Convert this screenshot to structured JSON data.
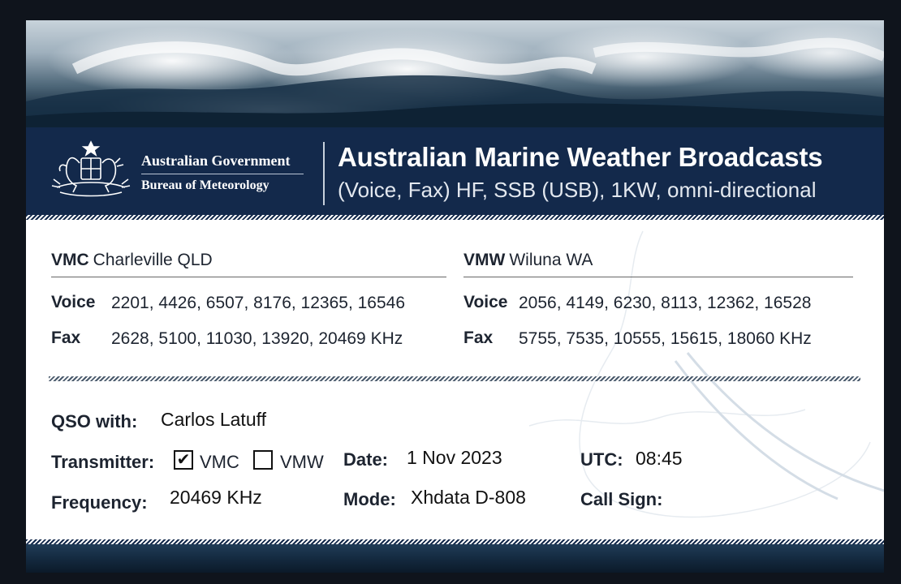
{
  "header": {
    "org_name": "Australian Government",
    "org_sub": "Bureau of Meteorology",
    "title": "Australian Marine Weather Broadcasts",
    "subtitle": "(Voice, Fax) HF, SSB (USB), 1KW, omni-directional"
  },
  "stations": [
    {
      "callsign": "VMC",
      "location": "Charleville QLD",
      "voice_label": "Voice",
      "voice": "2201, 4426, 6507, 8176, 12365, 16546",
      "fax_label": "Fax",
      "fax": "2628, 5100, 11030, 13920, 20469 KHz"
    },
    {
      "callsign": "VMW",
      "location": "Wiluna WA",
      "voice_label": "Voice",
      "voice": "2056, 4149, 6230, 8113, 12362, 16528",
      "fax_label": "Fax",
      "fax": "5755, 7535, 10555, 15615, 18060 KHz"
    }
  ],
  "report": {
    "qso_label": "QSO with:",
    "qso_value": "Carlos Latuff",
    "transmitter_label": "Transmitter:",
    "transmitter_options": [
      {
        "label": "VMC",
        "checked": true,
        "mark": "✔"
      },
      {
        "label": "VMW",
        "checked": false,
        "mark": ""
      }
    ],
    "date_label": "Date:",
    "date_value": "1 Nov 2023",
    "utc_label": "UTC:",
    "utc_value": "08:45",
    "frequency_label": "Frequency:",
    "frequency_value": "20469 KHz",
    "mode_label": "Mode:",
    "mode_value": "Xhdata D-808",
    "callsign_label": "Call Sign:",
    "callsign_value": ""
  },
  "colors": {
    "banner": "#13294b",
    "frame": "#0f141c",
    "text": "#1d2430"
  }
}
